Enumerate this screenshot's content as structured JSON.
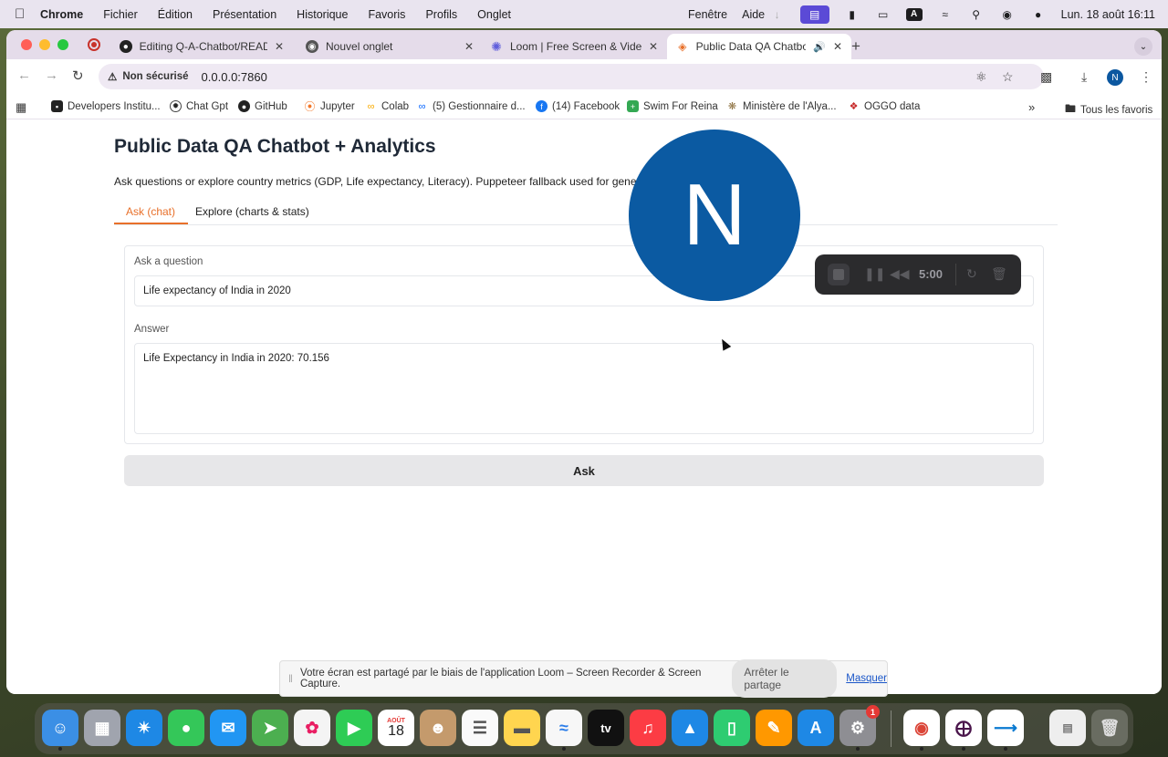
{
  "menubar": {
    "app": "Chrome",
    "items": [
      "Fichier",
      "Édition",
      "Présentation",
      "Historique",
      "Favoris",
      "Profils",
      "Onglet",
      "Fenêtre",
      "Aide"
    ],
    "clock": "Lun. 18 août  16:11",
    "keyboard_letter": "A"
  },
  "tabs": [
    {
      "title": "Editing Q-A-Chatbot/README",
      "icon": "github-icon"
    },
    {
      "title": "Nouvel onglet",
      "icon": "chrome-icon"
    },
    {
      "title": "Loom | Free Screen & Video R",
      "icon": "loom-icon"
    },
    {
      "title": "Public Data QA Chatbot +",
      "icon": "gradio-icon",
      "active": true
    }
  ],
  "toolbar": {
    "security": "Non sécurisé",
    "url": "0.0.0.0:7860",
    "profile_initial": "N"
  },
  "bookmarks": [
    "Developers Institu...",
    "Chat Gpt",
    "GitHub",
    "Jupyter",
    "Colab",
    "(5) Gestionnaire d...",
    "(14) Facebook",
    "Swim For Reina",
    "Ministère de l'Alya...",
    "OGGO data"
  ],
  "bookmarks_all": "Tous les favoris",
  "page": {
    "title": "Public Data QA Chatbot + Analytics",
    "description": "Ask questions or explore country metrics (GDP, Life expectancy, Literacy). Puppeteer fallback used for general web qu",
    "tabs": [
      "Ask (chat)",
      "Explore (charts & stats)"
    ],
    "question_label": "Ask a question",
    "question_value": "Life expectancy of India in 2020",
    "answer_label": "Answer",
    "answer_value": "Life Expectancy in India in 2020: 70.156",
    "ask_button": "Ask"
  },
  "loom": {
    "bubble_initial": "N",
    "timer": "5:00"
  },
  "sharebar": {
    "message": "Votre écran est partagé par le biais de l'application Loom – Screen Recorder & Screen Capture.",
    "stop_label": "Arrêter le partage",
    "hide_label": "Masquer"
  },
  "dock": {
    "calendar_month": "AOÛT",
    "calendar_day": "18",
    "tv_label": "tv",
    "settings_badge": "1"
  },
  "colors": {
    "accent": "#e8702a",
    "loom_blue": "#0b5aa2",
    "profile_blue": "#0b57a0"
  }
}
